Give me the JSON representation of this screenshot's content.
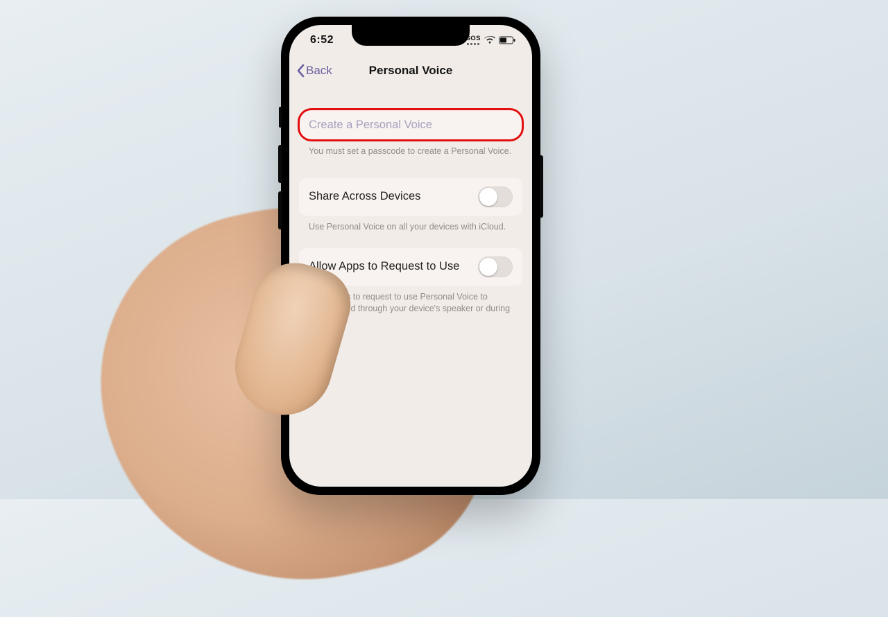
{
  "status": {
    "time": "6:52",
    "sos": "SOS"
  },
  "nav": {
    "back_label": "Back",
    "title": "Personal Voice"
  },
  "create": {
    "label": "Create a Personal Voice",
    "note": "You must set a passcode to create a Personal Voice."
  },
  "share": {
    "label": "Share Across Devices",
    "note": "Use Personal Voice on all your devices with iCloud.",
    "on": false
  },
  "allow": {
    "label": "Allow Apps to Request to Use",
    "note": "Allow apps to request to use Personal Voice to speak aloud through your device's speaker or during calls.",
    "on": false
  }
}
